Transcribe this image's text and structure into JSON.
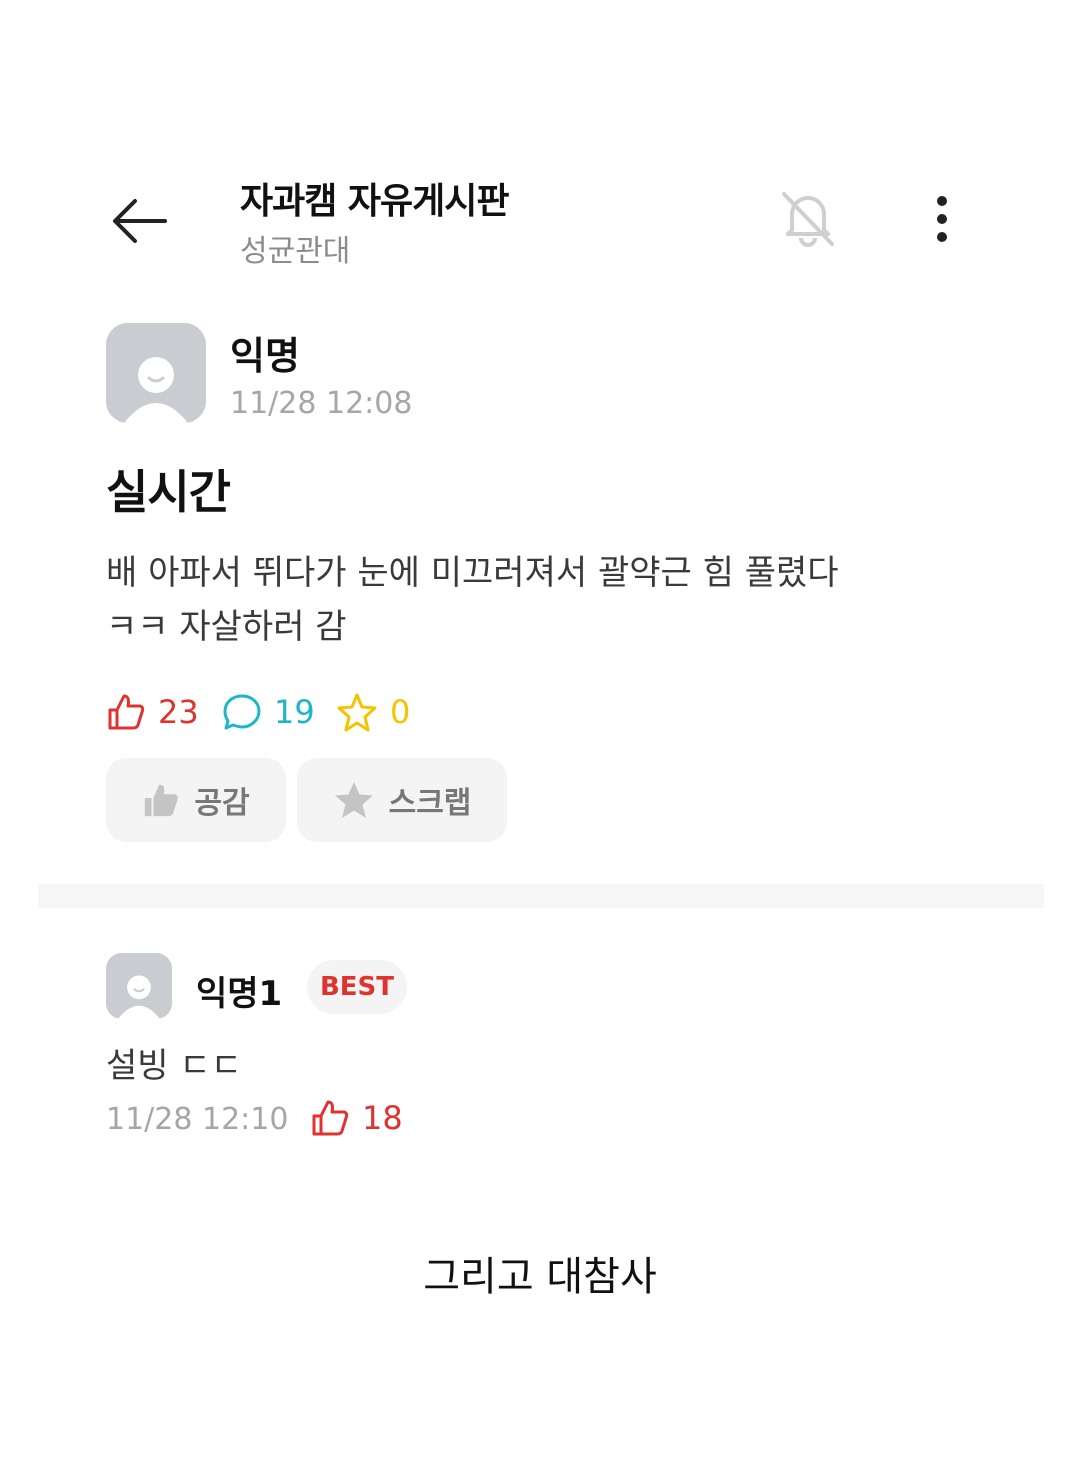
{
  "header": {
    "board_title": "자과캠 자유게시판",
    "board_subtitle": "성균관대",
    "icons": [
      "back-arrow-icon",
      "bell-off-icon",
      "more-vertical-icon"
    ]
  },
  "post": {
    "author": "익명",
    "time": "11/28 12:08",
    "title": "실시간",
    "body_lines": [
      "배 아파서 뛰다가 눈에 미끄러져서 괄약근 힘 풀렸다",
      "ㅋㅋ 자살하러 감"
    ],
    "stats": {
      "likes": "23",
      "comments": "19",
      "scraps": "0"
    },
    "buttons": {
      "like_label": "공감",
      "scrap_label": "스크랩"
    }
  },
  "comment": {
    "author": "익명1",
    "badge": "BEST",
    "body": "설빙 ㄷㄷ",
    "time": "11/28 12:10",
    "likes": "18"
  },
  "caption": "그리고 대참사",
  "colors": {
    "like": "#e0322e",
    "comment": "#1fb5c9",
    "scrap": "#f5c400",
    "muted": "#a6a6a6"
  }
}
